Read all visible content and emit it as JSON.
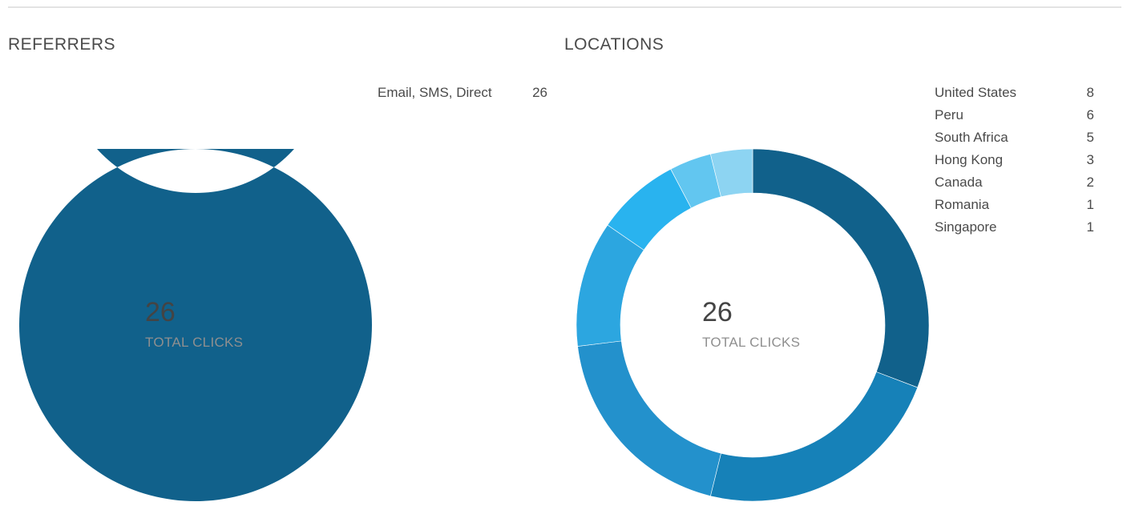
{
  "chart_data": [
    {
      "type": "pie",
      "variant": "donut",
      "title": "REFERRERS",
      "categories": [
        "Email, SMS, Direct"
      ],
      "values": [
        26
      ],
      "colors": [
        "#11618b"
      ],
      "center_value": "26",
      "center_label": "TOTAL CLICKS",
      "legend_position": "top-right"
    },
    {
      "type": "pie",
      "variant": "donut",
      "title": "LOCATIONS",
      "categories": [
        "United States",
        "Peru",
        "South Africa",
        "Hong Kong",
        "Canada",
        "Romania",
        "Singapore"
      ],
      "values": [
        8,
        6,
        5,
        3,
        2,
        1,
        1
      ],
      "colors": [
        "#11618b",
        "#1681b8",
        "#2391cc",
        "#2ca6e0",
        "#29b3ef",
        "#62c6f0",
        "#8dd4f2"
      ],
      "center_value": "26",
      "center_label": "TOTAL CLICKS",
      "legend_position": "top-right"
    }
  ]
}
